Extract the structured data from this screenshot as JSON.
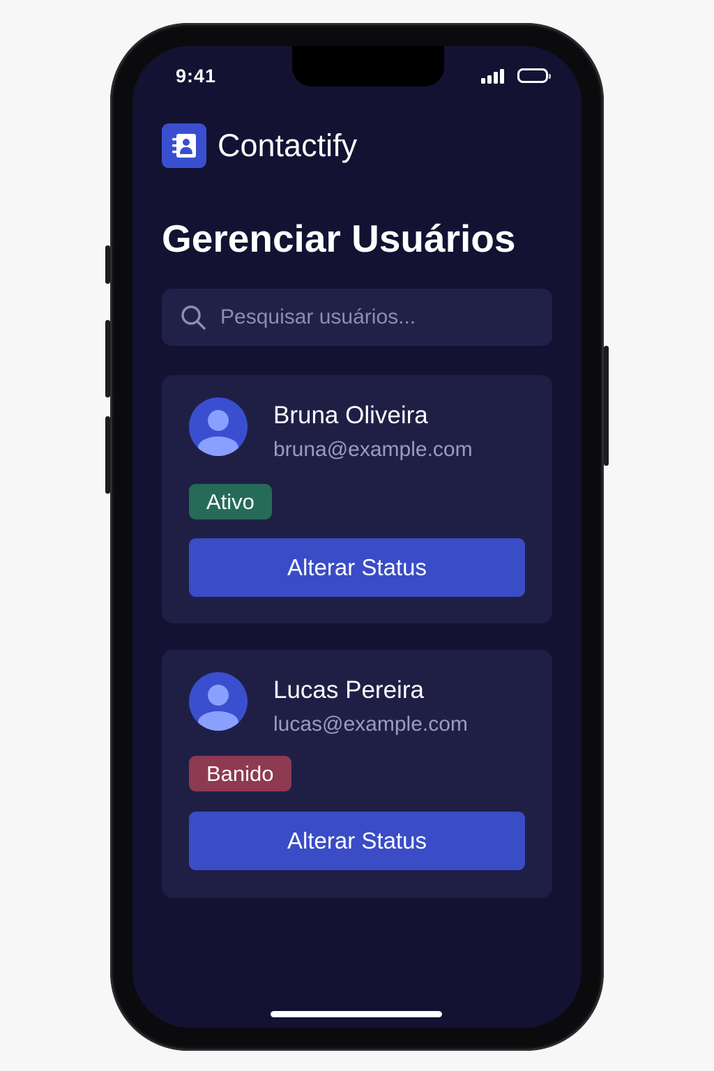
{
  "status_bar": {
    "time": "9:41"
  },
  "app": {
    "name": "Contactify",
    "accent_color": "#3a4fd0",
    "icon": "contacts-book-icon"
  },
  "page": {
    "title": "Gerenciar Usuários"
  },
  "search": {
    "placeholder": "Pesquisar usuários...",
    "value": "",
    "icon": "search-icon"
  },
  "users": [
    {
      "name": "Bruna Oliveira",
      "email": "bruna@example.com",
      "status": "Ativo",
      "status_color": "#256b58",
      "action_label": "Alterar Status"
    },
    {
      "name": "Lucas Pereira",
      "email": "lucas@example.com",
      "status": "Banido",
      "status_color": "#8e3a50",
      "action_label": "Alterar Status"
    }
  ]
}
